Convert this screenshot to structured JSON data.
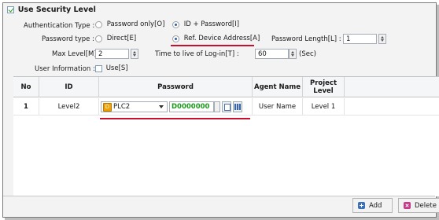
{
  "section": {
    "title": "Use Security Level",
    "checked": true
  },
  "auth": {
    "label": "Authentication Type :",
    "options": [
      {
        "label": "Password only[O]",
        "selected": false
      },
      {
        "label": "ID + Password[I]",
        "selected": true
      }
    ]
  },
  "password_type": {
    "label": "Password type :",
    "options": [
      {
        "label": "Direct[E]",
        "selected": false
      },
      {
        "label": "Ref. Device Address[A]",
        "selected": true
      }
    ]
  },
  "password_length": {
    "label": "Password Length[L] :",
    "value": "1"
  },
  "max_level": {
    "label": "Max Level[M] :",
    "value": "2"
  },
  "login_ttl": {
    "label": "Time to live of Log-in[T] :",
    "value": "60",
    "unit": "(Sec)"
  },
  "user_info": {
    "label": "User Information :",
    "checkbox_label": "Use[S]",
    "checked": false
  },
  "table": {
    "columns": [
      "No",
      "ID",
      "Password",
      "Agent Name",
      "Project Level"
    ],
    "rows": [
      {
        "no": "1",
        "id": "Level2",
        "device": "PLC2",
        "address": "D0000000",
        "agent": "User Name",
        "level": "Level 1"
      }
    ]
  },
  "buttons": {
    "add": "Add",
    "delete": "Delete"
  },
  "colors": {
    "accent_red": "#c8102e",
    "address_green": "#1a9a1a",
    "plc_orange": "#f0a000"
  }
}
